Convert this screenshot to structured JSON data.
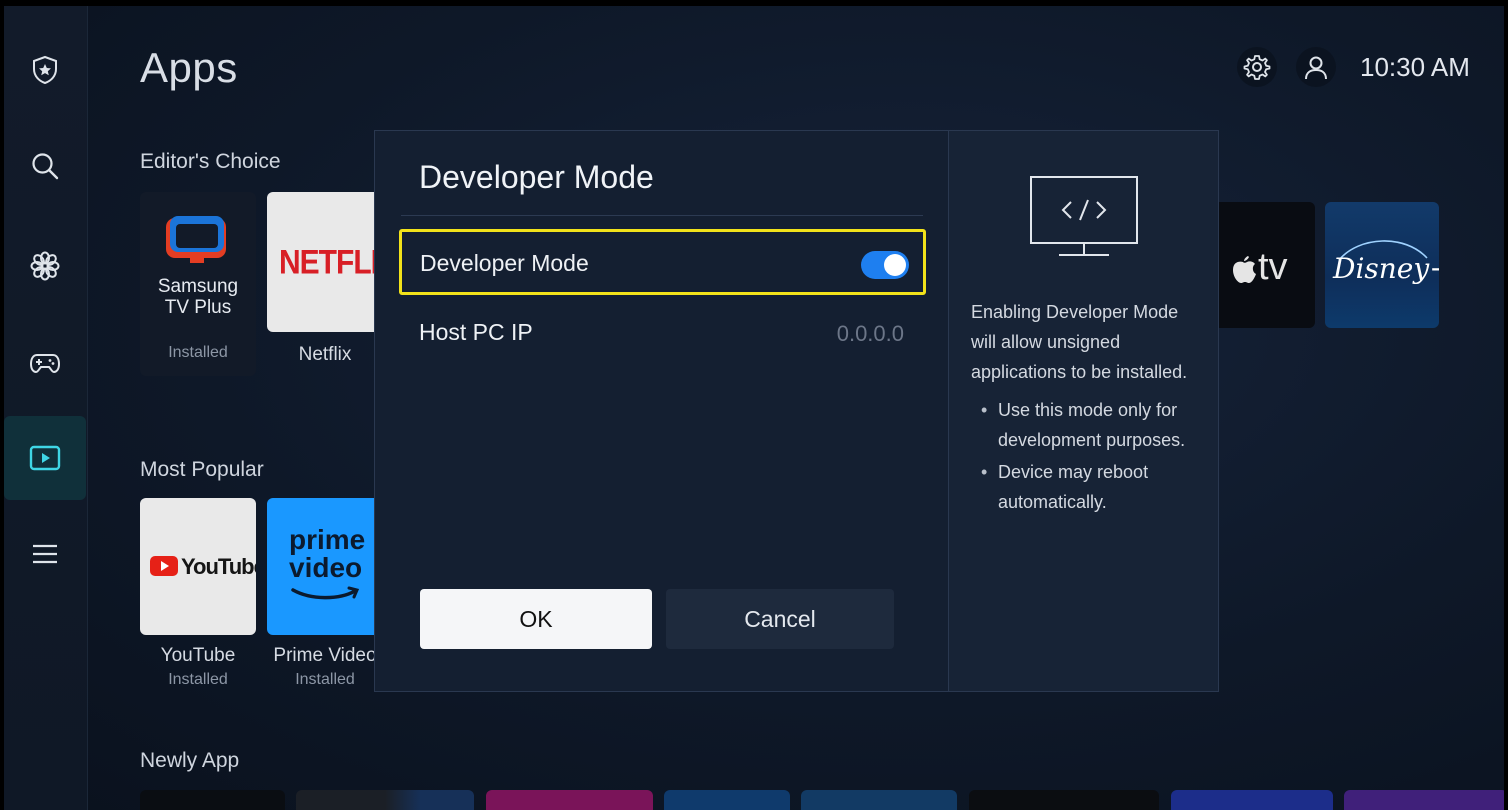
{
  "header": {
    "title": "Apps",
    "clock": "10:30 AM",
    "settings_icon": "gear-icon",
    "profile_icon": "user-icon"
  },
  "sidebar": {
    "items": [
      {
        "icon": "shield-star-icon"
      },
      {
        "icon": "search-icon"
      },
      {
        "icon": "flower-icon"
      },
      {
        "icon": "gamepad-icon"
      },
      {
        "icon": "play-icon",
        "active": true
      },
      {
        "icon": "menu-icon"
      }
    ]
  },
  "sections": {
    "editors_choice": {
      "title": "Editor's Choice",
      "tiles": [
        {
          "name": "Samsung\nTV Plus",
          "sub": "Installed",
          "logo_line1": "Samsung",
          "logo_line2": "TV Plus"
        },
        {
          "name": "Netflix",
          "logo": "NETFLIX"
        },
        {
          "logo": "tv"
        },
        {
          "logo": "Disney+"
        }
      ]
    },
    "most_popular": {
      "title": "Most Popular",
      "tiles": [
        {
          "name": "YouTube",
          "sub": "Installed",
          "logo": "YouTube"
        },
        {
          "name": "Prime Video",
          "sub": "Installed",
          "logo_line1": "prime",
          "logo_line2": "video"
        }
      ]
    },
    "newly_app": {
      "title": "Newly App"
    }
  },
  "dialog": {
    "title": "Developer Mode",
    "toggle_label": "Developer Mode",
    "toggle_on": true,
    "host_label": "Host PC IP",
    "host_value": "0.0.0.0",
    "ok_label": "OK",
    "cancel_label": "Cancel",
    "info_icon": "code-monitor-icon",
    "info_text": "Enabling Developer Mode will allow unsigned applications to be installed.",
    "bullets": [
      "Use this mode only for development purposes.",
      "Device may reboot automatically."
    ]
  },
  "colors": {
    "focus": "#f2e21a",
    "toggle": "#1e7ff0",
    "accent_active": "#3fd6e6"
  }
}
